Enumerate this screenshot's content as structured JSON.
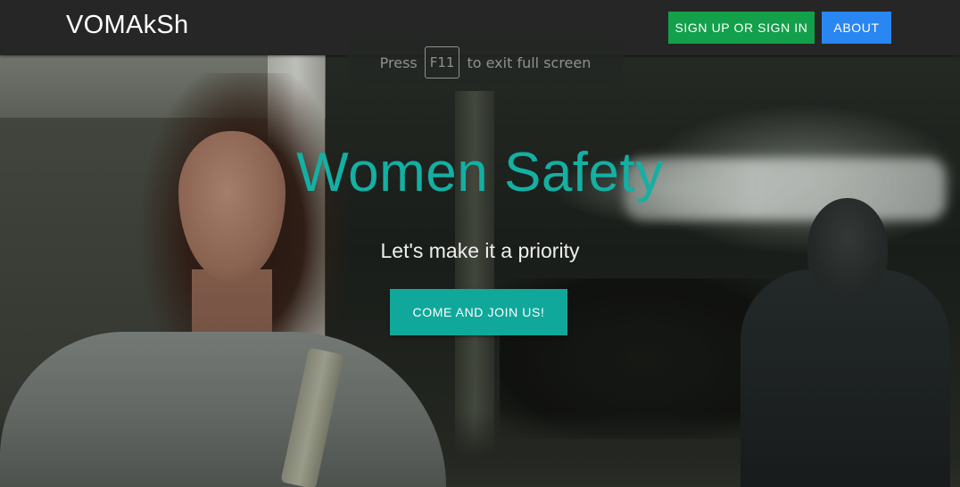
{
  "navbar": {
    "brand": "VOMAkSh",
    "signup_label": "SIGN UP OR SIGN IN",
    "about_label": "ABOUT"
  },
  "fullscreen_notice": {
    "prefix": "Press",
    "key": "F11",
    "suffix": "to exit full screen"
  },
  "hero": {
    "title": "Women Safety",
    "subtitle": "Let's make it a priority",
    "cta_label": "COME AND JOIN US!"
  },
  "colors": {
    "navbar_bg": "#262626",
    "signup_button": "#12a04a",
    "about_button": "#2a86f0",
    "accent_teal": "#13b0a3",
    "cta_button": "#10a89b"
  }
}
